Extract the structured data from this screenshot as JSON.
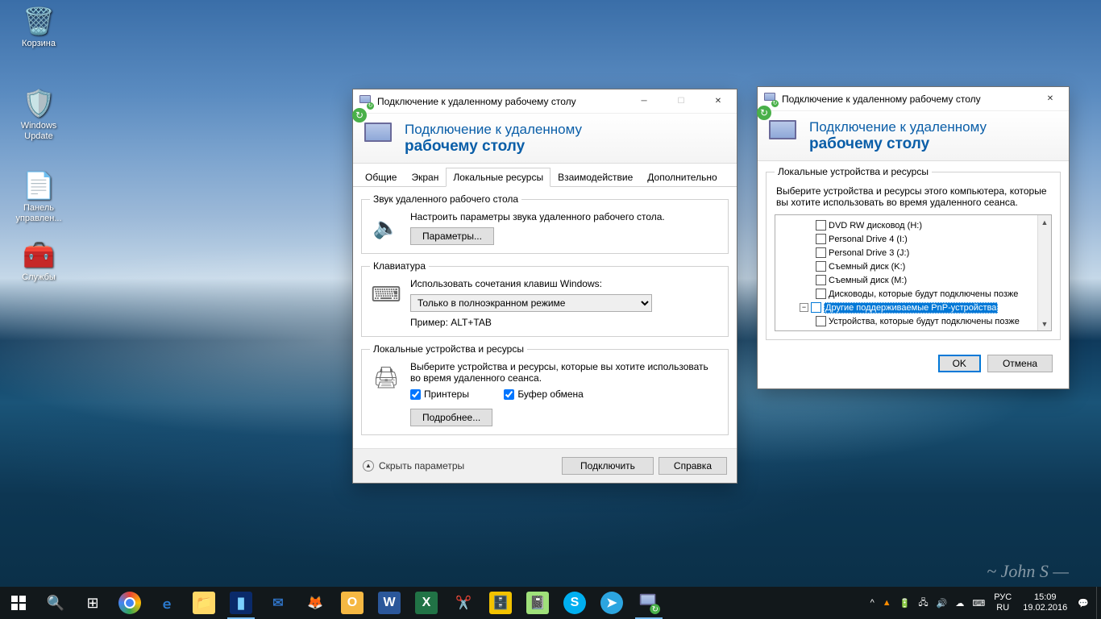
{
  "desktop_icons": [
    {
      "name": "recycle-bin",
      "label": "Корзина",
      "glyph": "🗑️"
    },
    {
      "name": "windows-update",
      "label": "Windows Update",
      "glyph": "🛡️"
    },
    {
      "name": "control-panel",
      "label": "Панель управлен...",
      "glyph": "📄"
    },
    {
      "name": "services",
      "label": "Службы",
      "glyph": "🧰"
    }
  ],
  "win1": {
    "title": "Подключение к удаленному рабочему столу",
    "banner_l1": "Подключение к удаленному",
    "banner_l2": "рабочему столу",
    "tabs": [
      "Общие",
      "Экран",
      "Локальные ресурсы",
      "Взаимодействие",
      "Дополнительно"
    ],
    "active_tab": 2,
    "sound": {
      "legend": "Звук удаленного рабочего стола",
      "desc": "Настроить параметры звука удаленного рабочего стола.",
      "btn": "Параметры..."
    },
    "keyboard": {
      "legend": "Клавиатура",
      "desc": "Использовать сочетания клавиш Windows:",
      "select": "Только в полноэкранном режиме",
      "example": "Пример: ALT+TAB"
    },
    "localres": {
      "legend": "Локальные устройства и ресурсы",
      "desc": "Выберите устройства и ресурсы, которые вы хотите использовать во время удаленного сеанса.",
      "printers": "Принтеры",
      "clipboard": "Буфер обмена",
      "more": "Подробнее..."
    },
    "hide": "Скрыть параметры",
    "connect": "Подключить",
    "help": "Справка"
  },
  "win2": {
    "title": "Подключение к удаленному рабочему столу",
    "banner_l1": "Подключение к удаленному",
    "banner_l2": "рабочему столу",
    "group_legend": "Локальные устройства и ресурсы",
    "group_desc": "Выберите устройства и ресурсы этого компьютера, которые вы хотите использовать во время удаленного сеанса.",
    "items": [
      "DVD RW дисковод (H:)",
      "Personal Drive 4 (I:)",
      "Personal Drive 3 (J:)",
      "Съемный диск (K:)",
      "Съемный диск (M:)",
      "Дисководы, которые будут подключены позже"
    ],
    "selected": "Другие поддерживаемые PnP-устройства",
    "sub_item": "Устройства, которые будут подключены позже",
    "ok": "OK",
    "cancel": "Отмена"
  },
  "taskbar": {
    "lang1": "РУС",
    "lang2": "RU",
    "time": "15:09",
    "date": "19.02.2016"
  }
}
